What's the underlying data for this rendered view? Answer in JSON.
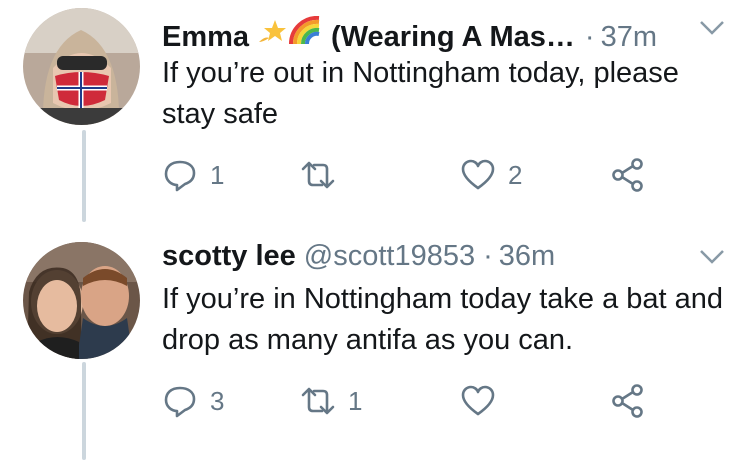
{
  "tweets": [
    {
      "name": "Emma",
      "display_suffix": "(Wearing A Mas…",
      "handle": "",
      "sep": "·",
      "time": "37m",
      "text": "If you’re out in Nottingham today, please stay safe",
      "emojis": [
        "dizzy-star",
        "rainbow"
      ],
      "reply_count": "1",
      "retweet_count": "",
      "like_count": "2"
    },
    {
      "name": "scotty lee",
      "handle": "@scott19853",
      "sep": "·",
      "time": "36m",
      "text": "If you’re in Nottingham today take a bat and drop as many antifa as you can.",
      "reply_count": "3",
      "retweet_count": "1",
      "like_count": ""
    }
  ],
  "colors": {
    "text": "#14171a",
    "secondary": "#657786",
    "thread_line": "#ccd6dd"
  }
}
